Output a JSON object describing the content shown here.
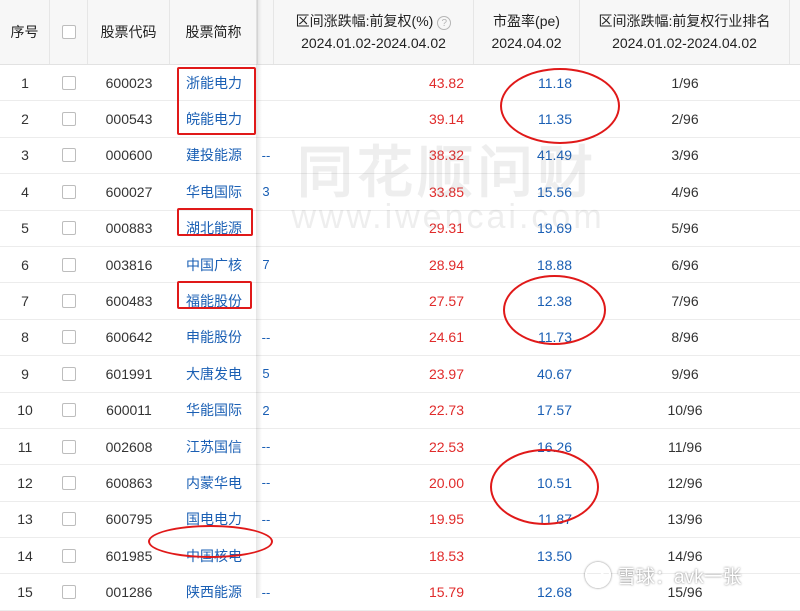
{
  "header": {
    "col_idx": "序号",
    "col_code": "股票代码",
    "col_name": "股票简称",
    "col_change_line1": "区间涨跌幅:前复权(%)",
    "col_change_line2": "2024.01.02-2024.04.02",
    "col_pe_line1": "市盈率(pe)",
    "col_pe_line2": "2024.04.02",
    "col_rank_line1": "区间涨跌幅:前复权行业排名",
    "col_rank_line2": "2024.01.02-2024.04.02"
  },
  "rows": [
    {
      "idx": "1",
      "code": "600023",
      "name": "浙能电力",
      "trunc": "",
      "change": "43.82",
      "pe": "11.18",
      "rank": "1/96"
    },
    {
      "idx": "2",
      "code": "000543",
      "name": "皖能电力",
      "trunc": "",
      "change": "39.14",
      "pe": "11.35",
      "rank": "2/96"
    },
    {
      "idx": "3",
      "code": "000600",
      "name": "建投能源",
      "trunc": "--",
      "change": "38.32",
      "pe": "41.49",
      "rank": "3/96"
    },
    {
      "idx": "4",
      "code": "600027",
      "name": "华电国际",
      "trunc": "3",
      "change": "33.85",
      "pe": "15.56",
      "rank": "4/96"
    },
    {
      "idx": "5",
      "code": "000883",
      "name": "湖北能源",
      "trunc": "",
      "change": "29.31",
      "pe": "19.69",
      "rank": "5/96"
    },
    {
      "idx": "6",
      "code": "003816",
      "name": "中国广核",
      "trunc": "7",
      "change": "28.94",
      "pe": "18.88",
      "rank": "6/96"
    },
    {
      "idx": "7",
      "code": "600483",
      "name": "福能股份",
      "trunc": "",
      "change": "27.57",
      "pe": "12.38",
      "rank": "7/96"
    },
    {
      "idx": "8",
      "code": "600642",
      "name": "申能股份",
      "trunc": "--",
      "change": "24.61",
      "pe": "11.73",
      "rank": "8/96"
    },
    {
      "idx": "9",
      "code": "601991",
      "name": "大唐发电",
      "trunc": "5",
      "change": "23.97",
      "pe": "40.67",
      "rank": "9/96"
    },
    {
      "idx": "10",
      "code": "600011",
      "name": "华能国际",
      "trunc": "2",
      "change": "22.73",
      "pe": "17.57",
      "rank": "10/96"
    },
    {
      "idx": "11",
      "code": "002608",
      "name": "江苏国信",
      "trunc": "--",
      "change": "22.53",
      "pe": "16.26",
      "rank": "11/96"
    },
    {
      "idx": "12",
      "code": "600863",
      "name": "内蒙华电",
      "trunc": "--",
      "change": "20.00",
      "pe": "10.51",
      "rank": "12/96"
    },
    {
      "idx": "13",
      "code": "600795",
      "name": "国电电力",
      "trunc": "--",
      "change": "19.95",
      "pe": "11.87",
      "rank": "13/96"
    },
    {
      "idx": "14",
      "code": "601985",
      "name": "中国核电",
      "trunc": "",
      "change": "18.53",
      "pe": "13.50",
      "rank": "14/96"
    },
    {
      "idx": "15",
      "code": "001286",
      "name": "陕西能源",
      "trunc": "--",
      "change": "15.79",
      "pe": "12.68",
      "rank": "15/96"
    }
  ],
  "watermark": {
    "text": "同花顺问财",
    "url": "www.iwencai.com"
  },
  "logo": {
    "text": "雪球：avk一张"
  },
  "colors": {
    "positive": "#e02b2b",
    "link": "#1a5fb4",
    "annotation": "#e01919"
  }
}
